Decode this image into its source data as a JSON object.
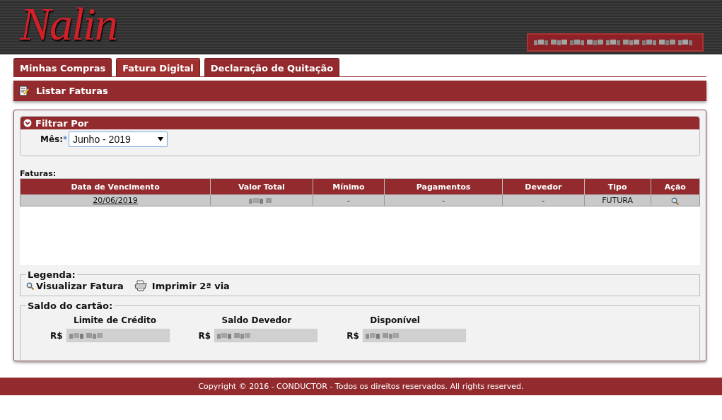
{
  "header": {
    "logo": "Nalin"
  },
  "tabs": [
    {
      "label": "Minhas Compras",
      "selected": false
    },
    {
      "label": "Fatura Digital",
      "selected": true
    },
    {
      "label": "Declaração de Quitação",
      "selected": false
    }
  ],
  "page_title": "Listar Faturas",
  "filter": {
    "title": "Filtrar Por",
    "expanded": true,
    "month_label": "Mês:",
    "required_mark": "*",
    "month_value": "Junho - 2019"
  },
  "invoices": {
    "label": "Faturas:",
    "columns": [
      "Data de Vencimento",
      "Valor Total",
      "Mínimo",
      "Pagamentos",
      "Devedor",
      "Tipo",
      "Ação"
    ],
    "rows": [
      {
        "due_date": "20/06/2019",
        "minimum": "-",
        "payments": "-",
        "debtor": "-",
        "type": "FUTURA"
      }
    ]
  },
  "legend": {
    "title": "Legenda:",
    "items": [
      {
        "kind": "view",
        "label": "Visualizar Fatura"
      },
      {
        "kind": "print",
        "label": "Imprimir 2ª via"
      }
    ]
  },
  "balance": {
    "title": "Saldo do cartão:",
    "fields": [
      {
        "label": "Limite de Crédito",
        "currency": "R$"
      },
      {
        "label": "Saldo Devedor",
        "currency": "R$"
      },
      {
        "label": "Disponível",
        "currency": "R$"
      }
    ]
  },
  "footer": "Copyright © 2016 - CONDUCTOR - Todos os direitos reservados. All rights reserved."
}
